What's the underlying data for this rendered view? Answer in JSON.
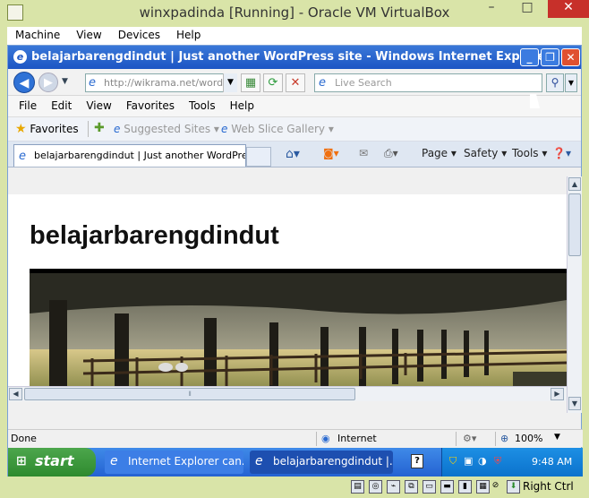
{
  "vbox": {
    "title": "winxpadinda [Running] - Oracle VM VirtualBox",
    "menu": [
      "Machine",
      "View",
      "Devices",
      "Help"
    ],
    "right_ctrl": "Right Ctrl"
  },
  "ie": {
    "title": "belajarbarengdindut | Just another WordPress site - Windows Internet Explorer",
    "url": "http://wikrama.net/wordpi",
    "search_placeholder": "Live Search",
    "menu": [
      "File",
      "Edit",
      "View",
      "Favorites",
      "Tools",
      "Help"
    ],
    "favorites_label": "Favorites",
    "fav_items": [
      "Suggested Sites ▾",
      "Web Slice Gallery ▾"
    ],
    "tab_title": "belajarbarengdindut | Just another WordPres...",
    "commands": [
      "Page ▾",
      "Safety ▾",
      "Tools ▾"
    ],
    "status_done": "Done",
    "status_zone": "Internet",
    "zoom": "100%"
  },
  "page": {
    "site_title": "belajarbarengdindut"
  },
  "taskbar": {
    "start": "start",
    "tasks": [
      "Internet Explorer can...",
      "belajarbarengdindut |..."
    ],
    "clock": "9:48 AM"
  }
}
